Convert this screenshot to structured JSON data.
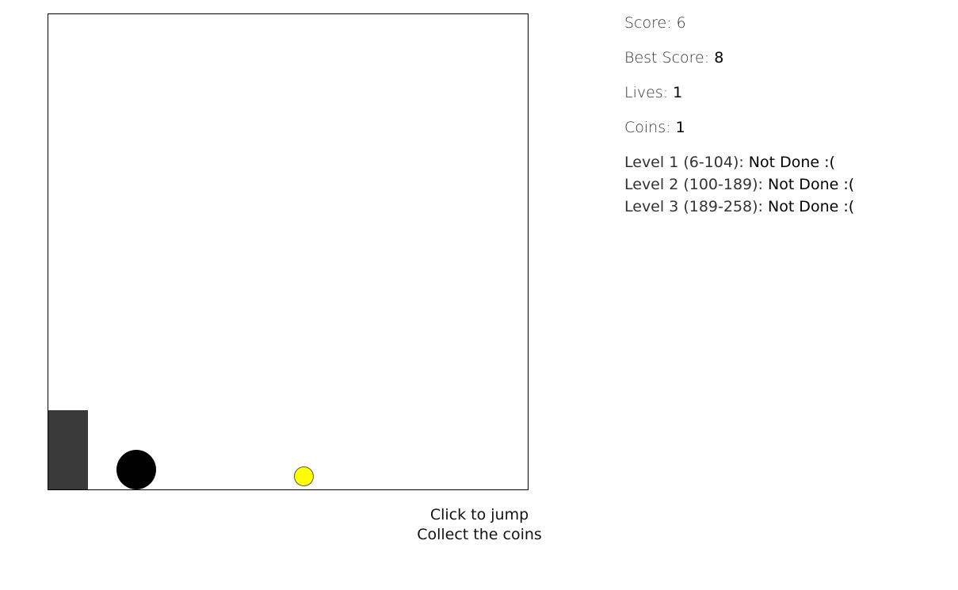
{
  "game": {
    "colors": {
      "obstacle": "#3a3a3a",
      "player": "#000000",
      "coin": "#ffff00",
      "border": "#000000"
    }
  },
  "instructions": {
    "line1": "Click to jump",
    "line2": "Collect the coins"
  },
  "stats": {
    "score_label": "Score: ",
    "score_value": "6",
    "best_label": "Best Score: ",
    "best_value": "8",
    "lives_label": "Lives: ",
    "lives_value": "1",
    "coins_label": "Coins: ",
    "coins_value": "1"
  },
  "levels": [
    {
      "label": "Level 1 (6-104): ",
      "status": "Not Done :("
    },
    {
      "label": "Level 2 (100-189): ",
      "status": "Not Done :("
    },
    {
      "label": "Level 3 (189-258): ",
      "status": "Not Done :("
    }
  ]
}
